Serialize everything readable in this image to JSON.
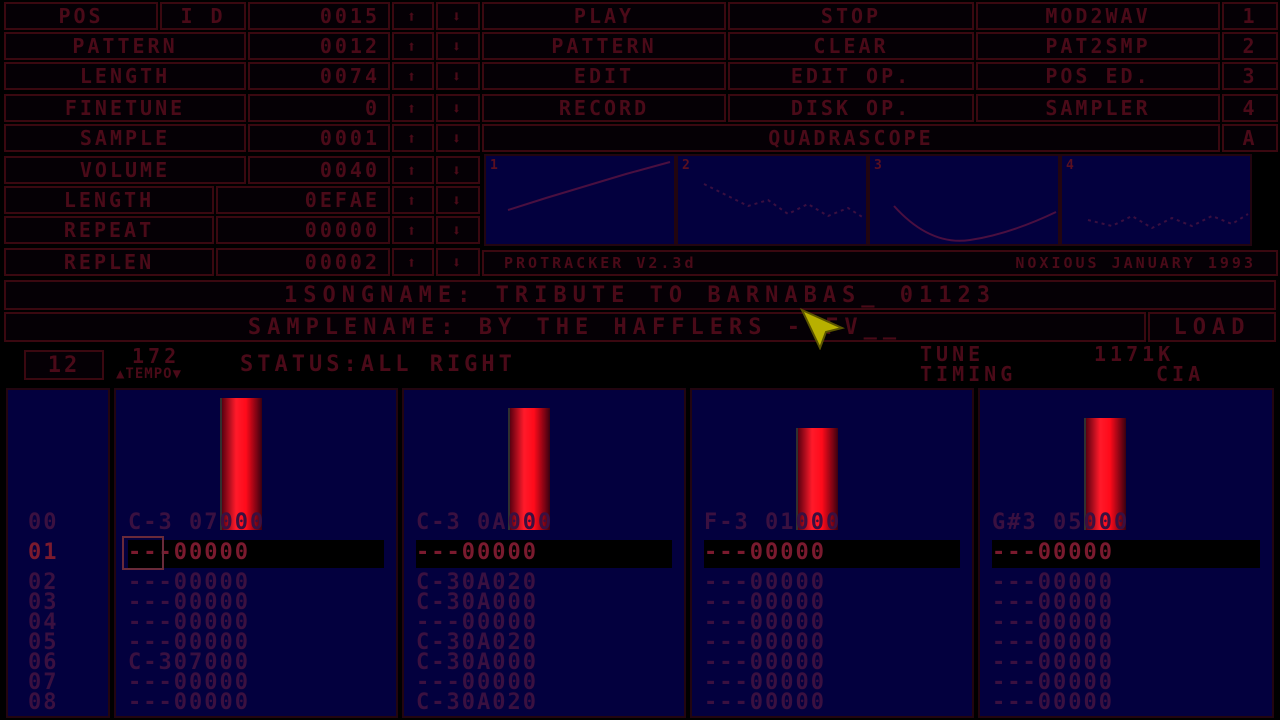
{
  "top_left": {
    "pos": {
      "label": "POS",
      "flag": "I D",
      "value": "0015"
    },
    "pattern": {
      "label": "PATTERN",
      "value": "0012"
    },
    "length": {
      "label": "LENGTH",
      "value": "0074"
    },
    "finetune": {
      "label": "FINETUNE",
      "value": "0"
    },
    "sample": {
      "label": "SAMPLE",
      "value": "0001"
    },
    "volume": {
      "label": "VOLUME",
      "value": "0040"
    },
    "slength": {
      "label": "LENGTH",
      "value": "0EFAE"
    },
    "repeat": {
      "label": "REPEAT",
      "value": "00000"
    },
    "replen": {
      "label": "REPLEN",
      "value": "00002"
    }
  },
  "arrows": {
    "up": "⬆",
    "down": "⬇"
  },
  "buttons": {
    "play": "PLAY",
    "stop": "STOP",
    "mod2wav": "MOD2WAV",
    "n1": "1",
    "pattern": "PATTERN",
    "clear": "CLEAR",
    "pat2smp": "PAT2SMP",
    "n2": "2",
    "edit": "EDIT",
    "edit_op": "EDIT OP.",
    "pos_ed": "POS ED.",
    "n3": "3",
    "record": "RECORD",
    "disk_op": "DISK OP.",
    "sampler": "SAMPLER",
    "n4": "4",
    "quadrascope": "QUADRASCOPE",
    "a": "A"
  },
  "scope_numbers": [
    "1",
    "2",
    "3",
    "4"
  ],
  "version": "PROTRACKER V2.3d",
  "credit": "NOXIOUS JANUARY 1993",
  "songname": "1SONGNAME: TRIBUTE TO BARNABAS_ 01123",
  "samplename": "SAMPLENAME: BY THE HAFFLERS - FV__",
  "load": "LOAD",
  "status_bar": {
    "octave": "12",
    "tempo_value": "172",
    "tempo_label": "▲TEMPO▼",
    "status": "STATUS:ALL RIGHT",
    "tune_label": "TUNE",
    "tune_value": "1171K",
    "timing_label": "TIMING",
    "timing_value": "CIA"
  },
  "row_numbers": [
    "00",
    "01",
    "02",
    "03",
    "04",
    "05",
    "06",
    "07",
    "08"
  ],
  "tracks": [
    {
      "vu": 0.4,
      "rows": [
        "C-3 07000",
        "---00000",
        "---00000",
        "---00000",
        "---00000",
        "---00000",
        "C-307000",
        "---00000",
        "---00000"
      ]
    },
    {
      "vu": 0.37,
      "rows": [
        "C-3 0A000",
        "---00000",
        "C-30A020",
        "C-30A000",
        "---00000",
        "C-30A020",
        "C-30A000",
        "---00000",
        "C-30A020"
      ]
    },
    {
      "vu": 0.31,
      "rows": [
        "F-3 01000",
        "---00000",
        "---00000",
        "---00000",
        "---00000",
        "---00000",
        "---00000",
        "---00000",
        "---00000"
      ]
    },
    {
      "vu": 0.34,
      "rows": [
        "G#3 05000",
        "---00000",
        "---00000",
        "---00000",
        "---00000",
        "---00000",
        "---00000",
        "---00000",
        "---00000"
      ]
    }
  ],
  "colors": {
    "accent": "#4a0a18",
    "scope_bg": "#03003e",
    "vu": "#ff1a2a"
  }
}
